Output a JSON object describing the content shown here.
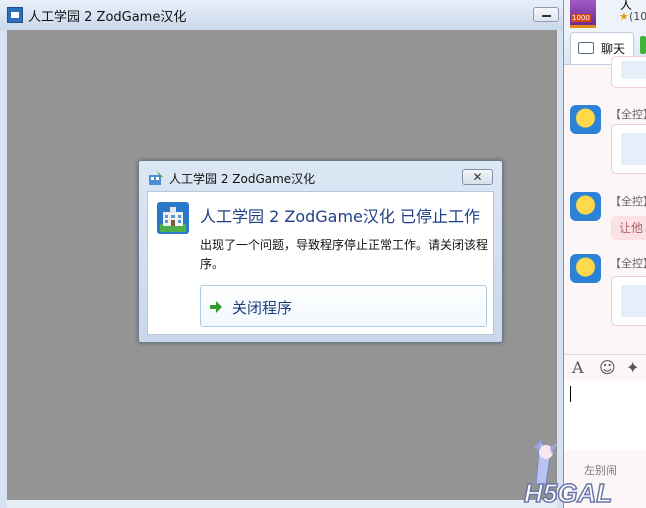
{
  "window": {
    "title": "人工学园 2  ZodGame汉化"
  },
  "dialog": {
    "title": "人工学园 2  ZodGame汉化",
    "close_symbol": "✕",
    "heading": "人工学园 2  ZodGame汉化 已停止工作",
    "message": "出现了一个问题，导致程序停止正常工作。请关闭该程序。",
    "close_program_label": "关闭程序"
  },
  "chat": {
    "header_name": "人",
    "header_sub": "(10",
    "header_badge": "1000",
    "tab_label": "聊天",
    "messages": [
      {
        "sender": "【全控】"
      },
      {
        "sender": "【全控】",
        "text": "让他"
      },
      {
        "sender": "【全控】"
      }
    ],
    "footer_text": "左别闹"
  },
  "watermark": "H5GAL",
  "colors": {
    "client_area": "#949494",
    "dialog_heading": "#1f3f86",
    "chat_bg": "#fdf6f7",
    "chat_bubble": "#fbe1e5"
  }
}
